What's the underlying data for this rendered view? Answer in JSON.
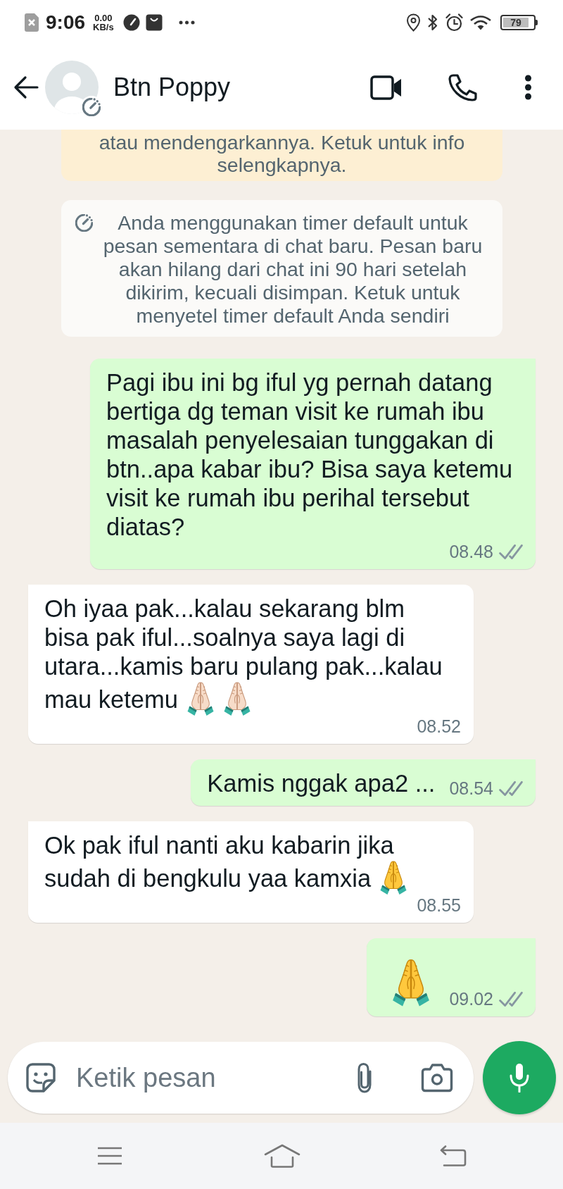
{
  "status_bar": {
    "time": "9:06",
    "speed_value": "0.00",
    "speed_unit": "KB/s",
    "battery": "79"
  },
  "header": {
    "contact_name": "Btn Poppy",
    "disappearing_messages": true
  },
  "notices": [
    {
      "kind": "info",
      "text": "atau mendengarkannya. Ketuk untuk info selengkapnya."
    },
    {
      "kind": "timer",
      "text": "Anda menggunakan timer default untuk pesan sementara di chat baru. Pesan baru akan hilang dari chat ini 90 hari setelah dikirim, kecuali disimpan. Ketuk untuk menyetel timer default Anda sendiri"
    }
  ],
  "messages": [
    {
      "kind": "outgoing",
      "text": "Pagi ibu ini bg iful yg pernah datang bertiga dg teman visit ke rumah ibu masalah penyelesaian tunggakan di btn..apa kabar ibu? Bisa saya ketemu visit ke rumah ibu perihal tersebut diatas?",
      "time": "08.48",
      "delivered": true,
      "read": false
    },
    {
      "kind": "incoming",
      "text": "Oh iyaa pak...kalau sekarang blm bisa pak iful...soalnya saya lagi di utara...kamis baru pulang pak...kalau mau ketemu",
      "emojis": [
        {
          "light_skin": true
        },
        {
          "light_skin": true
        }
      ],
      "time": "08.52"
    },
    {
      "kind": "outgoing",
      "text": "Kamis nggak apa2 ...",
      "time": "08.54",
      "delivered": true,
      "read": false
    },
    {
      "kind": "incoming",
      "text": "Ok pak iful nanti aku kabarin jika sudah di bengkulu yaa kamxia",
      "emojis": [
        {
          "light_skin": false
        }
      ],
      "time": "08.55"
    },
    {
      "kind": "outgoing",
      "emojis": [
        {
          "light_skin": false
        }
      ],
      "time": "09.02",
      "delivered": true,
      "read": false
    }
  ],
  "composer": {
    "placeholder": "Ketik pesan"
  }
}
